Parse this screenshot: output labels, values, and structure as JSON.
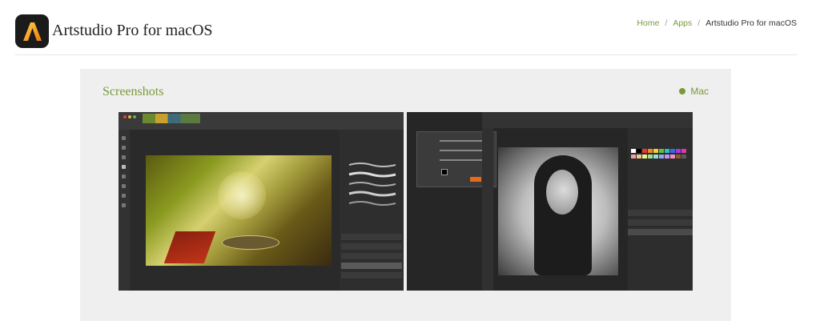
{
  "header": {
    "app_title": "Artstudio Pro for macOS",
    "icon": "artstudio-logo-icon"
  },
  "breadcrumb": {
    "items": [
      {
        "label": "Home"
      },
      {
        "label": "Apps"
      },
      {
        "label": "Artstudio Pro for macOS"
      }
    ],
    "separator": "/"
  },
  "screenshots": {
    "title": "Screenshots",
    "platform": "Mac",
    "accent": "#7a9a3a",
    "images": [
      {
        "name": "painting-screenshot",
        "depicts": "forest-boat-painting"
      },
      {
        "name": "portrait-screenshot",
        "depicts": "black-and-white-portrait"
      }
    ]
  }
}
